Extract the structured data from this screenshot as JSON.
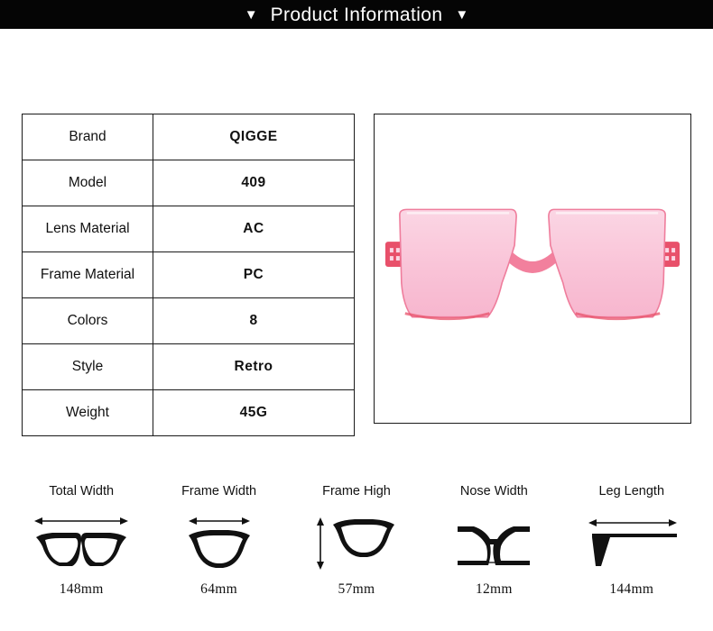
{
  "header": {
    "title": "Product Information",
    "left_marker": "▼",
    "right_marker": "▼",
    "background_color": "#050505",
    "text_color": "#ffffff"
  },
  "spec_table": {
    "rows": [
      {
        "key": "Brand",
        "value": "QIGGE"
      },
      {
        "key": "Model",
        "value": "409"
      },
      {
        "key": "Lens Material",
        "value": "AC"
      },
      {
        "key": "Frame Material",
        "value": "PC"
      },
      {
        "key": "Colors",
        "value": "8"
      },
      {
        "key": "Style",
        "value": "Retro"
      },
      {
        "key": "Weight",
        "value": "45G"
      }
    ]
  },
  "product_image": {
    "alt": "pink oversized rimless square sunglasses",
    "lens_color": "#f9c2d6",
    "lens_color_light": "#fbd6e4",
    "frame_accent_color": "#e8506a",
    "temple_color": "#f49bb6",
    "background_color": "#ffffff"
  },
  "measurements": [
    {
      "label": "Total Width",
      "value": "148mm",
      "icon": "full-glasses-icon",
      "arrow": "horizontal"
    },
    {
      "label": "Frame Width",
      "value": "64mm",
      "icon": "single-lens-icon",
      "arrow": "horizontal"
    },
    {
      "label": "Frame High",
      "value": "57mm",
      "icon": "single-lens-icon",
      "arrow": "vertical"
    },
    {
      "label": "Nose Width",
      "value": "12mm",
      "icon": "nose-bridge-icon",
      "arrow": "horizontal-small"
    },
    {
      "label": "Leg Length",
      "value": "144mm",
      "icon": "temple-arm-icon",
      "arrow": "horizontal"
    }
  ]
}
